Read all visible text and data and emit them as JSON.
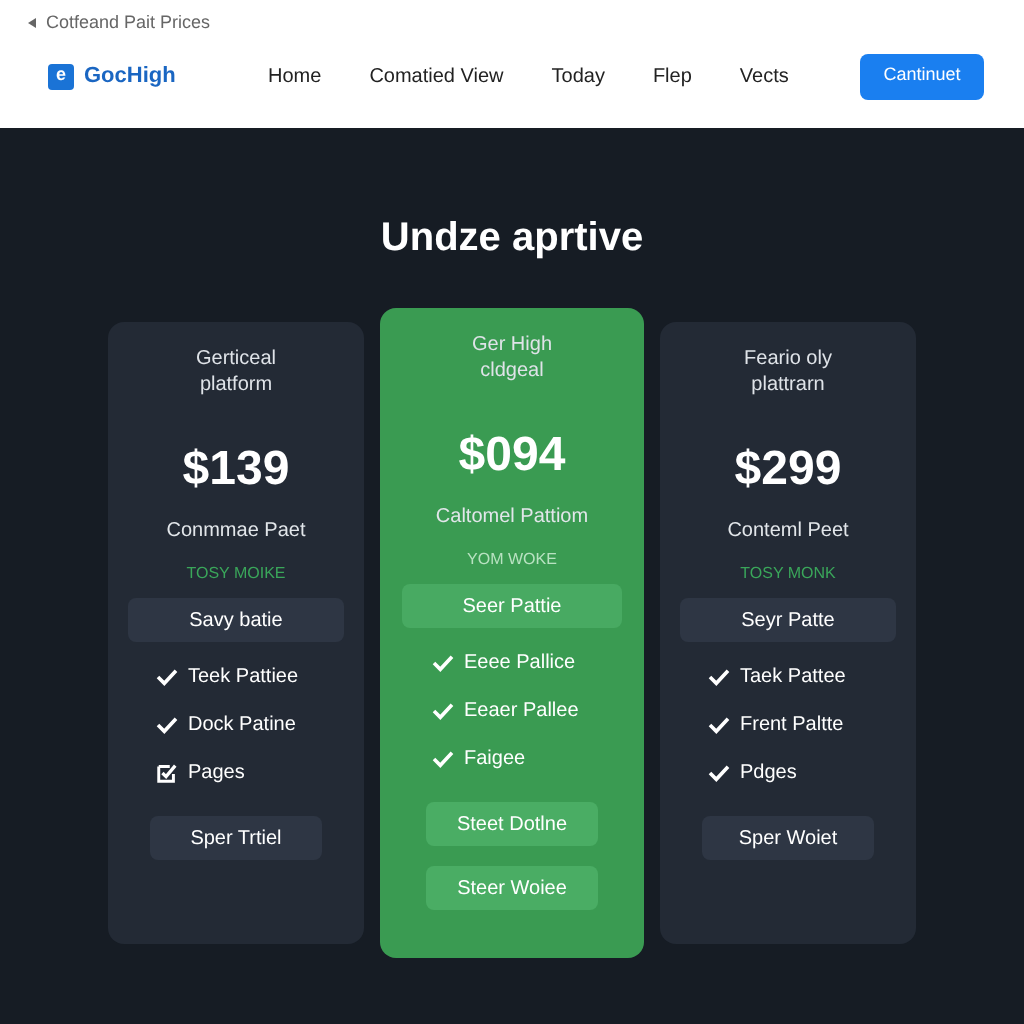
{
  "breadcrumb": "Cotfeand Pait Prices",
  "logo": {
    "mark": "e",
    "name": "GocHigh"
  },
  "nav": [
    {
      "label": "Home"
    },
    {
      "label": "Comatied View"
    },
    {
      "label": "Today"
    },
    {
      "label": "Flep"
    },
    {
      "label": "Vects"
    }
  ],
  "cta": "Cantinuet",
  "heading": "Undze aprtive",
  "plans": [
    {
      "featured": false,
      "subtitle": "Gerticeal platform",
      "price": "$139",
      "name": "Conmmae Paet",
      "tag": "TOSY MOIKE",
      "select": "Savy batie",
      "features": [
        {
          "kind": "check",
          "label": "Teek Pattiee"
        },
        {
          "kind": "check",
          "label": "Dock Patine"
        },
        {
          "kind": "box",
          "label": "Pages"
        }
      ],
      "buttons": [
        "Sper Trtiel"
      ]
    },
    {
      "featured": true,
      "subtitle": "Ger High cldgeal",
      "price": "$094",
      "name": "Caltomel Pattiom",
      "tag": "YOM WOKE",
      "select": "Seer Pattie",
      "features": [
        {
          "kind": "check",
          "label": "Eeee Pallice"
        },
        {
          "kind": "check",
          "label": "Eeaer Pallee"
        },
        {
          "kind": "check",
          "label": "Faigee"
        }
      ],
      "buttons": [
        "Steet Dotlne",
        "Steer Woiee"
      ]
    },
    {
      "featured": false,
      "subtitle": "Feario oly plattrarn",
      "price": "$299",
      "name": "Conteml Peet",
      "tag": "TOSY MONK",
      "select": "Seyr Patte",
      "features": [
        {
          "kind": "check",
          "label": "Taek Pattee"
        },
        {
          "kind": "check",
          "label": "Frent Paltte"
        },
        {
          "kind": "check",
          "label": "Pdges"
        }
      ],
      "buttons": [
        "Sper Woiet"
      ]
    }
  ]
}
